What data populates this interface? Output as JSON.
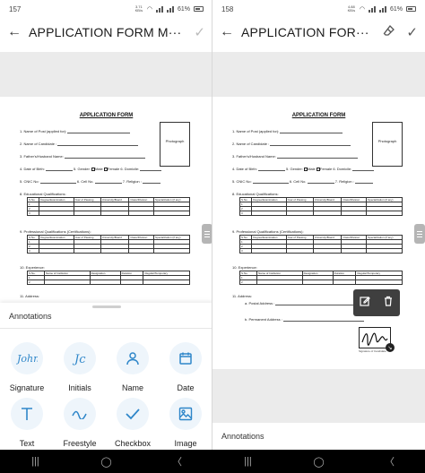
{
  "left": {
    "status": {
      "time": "157",
      "net_speed": "3.71 KB/s",
      "battery": "61%"
    },
    "appbar": {
      "title": "APPLICATION FORM M···"
    },
    "sheet": {
      "title": "Annotations",
      "tools": [
        {
          "label": "Signature",
          "icon": "signature-icon"
        },
        {
          "label": "Initials",
          "icon": "initials-icon"
        },
        {
          "label": "Name",
          "icon": "person-icon"
        },
        {
          "label": "Date",
          "icon": "calendar-icon"
        },
        {
          "label": "Text",
          "icon": "text-icon"
        },
        {
          "label": "Freestyle",
          "icon": "freestyle-icon"
        },
        {
          "label": "Checkbox",
          "icon": "checkmark-icon"
        },
        {
          "label": "Image",
          "icon": "image-icon"
        }
      ]
    }
  },
  "right": {
    "status": {
      "time": "158",
      "net_speed": "4.88 KB/s",
      "battery": "61%"
    },
    "appbar": {
      "title": "APPLICATION FOR···"
    },
    "annotations_label": "Annotations"
  },
  "form": {
    "title": "APPLICATION FORM",
    "photo_label": "Photograph",
    "rows": [
      "1.   Name of Post (applied for):",
      "2.   Name of Candidate :",
      "3.   Father's/Husband Name:",
      "4.   Date of Birth:",
      "5.   CNIC No:",
      "8.   Educational Qualifications:",
      "9.   Professional Qualifications (Certifications):",
      "10. Experience:",
      "11. Address:"
    ],
    "gender_label": "5. Gender:",
    "male": "Male",
    "female": "Female",
    "domicile": "6. Domicile:",
    "cell": "6. Cell No.",
    "religion": "7. Religion :",
    "edu_headers": [
      "S.No.",
      "Degree/Examination",
      "Year of Passing",
      "University/Board",
      "Class/Division",
      "Specialization (if any)"
    ],
    "exp_headers": [
      "S.No.",
      "Name of Institution",
      "Designation",
      "Duration",
      "Regular/Temporary"
    ],
    "postal": "a.   Postal Address :",
    "permanent": "b.   Permanent Address :",
    "sig_caption": "Signature of Candidate"
  },
  "colors": {
    "accent": "#2e86c9",
    "tool_bg": "#eef5fb",
    "popup": "#3f3f3f"
  }
}
